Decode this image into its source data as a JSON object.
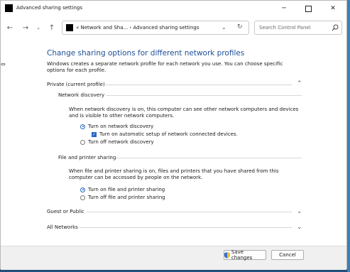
{
  "window": {
    "title": "Advanced sharing settings"
  },
  "nav": {
    "address_text": "« Network and Sha... › Advanced sharing settings",
    "search_placeholder": "Search Control Panel"
  },
  "main": {
    "heading": "Change sharing options for different network profiles",
    "intro": "Windows creates a separate network profile for each network you use. You can choose specific options for each profile.",
    "profiles": {
      "private_label": "Private (current profile)",
      "guest_label": "Guest or Public",
      "all_label": "All Networks"
    },
    "network_discovery": {
      "title": "Network discovery",
      "description": "When network discovery is on, this computer can see other network computers and devices and is visible to other network computers.",
      "on_label": "Turn on network discovery",
      "auto_setup_label": "Turn on automatic setup of network connected devices.",
      "off_label": "Turn off network discovery",
      "selected": "on",
      "auto_setup_checked": true
    },
    "file_printer": {
      "title": "File and printer sharing",
      "description": "When file and printer sharing is on, files and printers that you have shared from this computer can be accessed by people on the network.",
      "on_label": "Turn on file and printer sharing",
      "off_label": "Turn off file and printer sharing",
      "selected": "on"
    }
  },
  "footer": {
    "save_label": "Save changes",
    "cancel_label": "Cancel"
  },
  "colors": {
    "heading": "#1c4e96",
    "accent": "#2466c7"
  }
}
